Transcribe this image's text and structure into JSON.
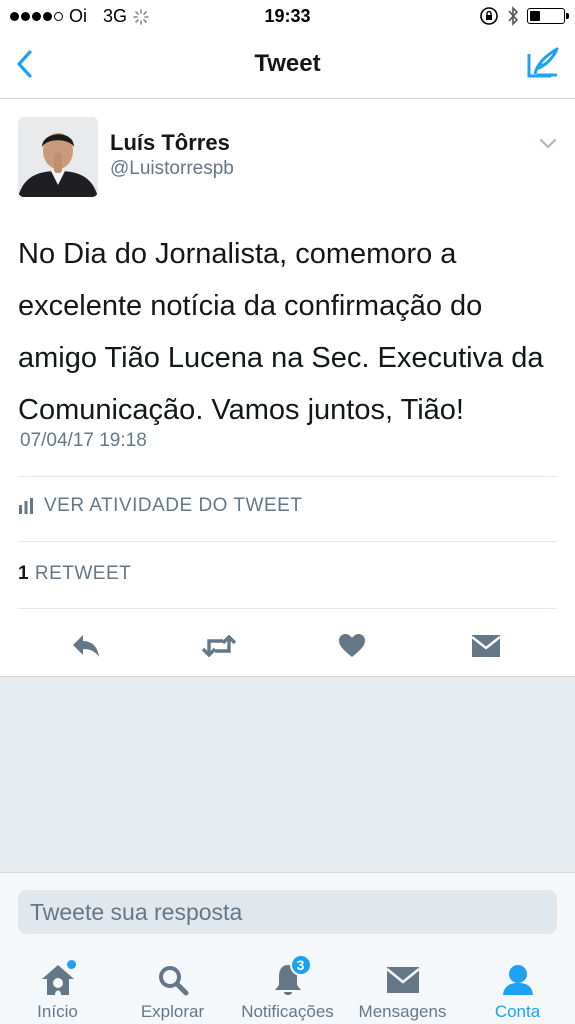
{
  "status_bar": {
    "carrier": "Oi",
    "network": "3G",
    "time": "19:33"
  },
  "nav": {
    "title": "Tweet"
  },
  "tweet": {
    "author_name": "Luís Tôrres",
    "author_handle": "@Luistorrespb",
    "text": "No Dia do Jornalista, comemoro a excelente notícia da confirmação do amigo Tião Lucena na Sec. Executiva da Comunicação. Vamos juntos, Tião!",
    "timestamp": "07/04/17 19:18",
    "activity_label": "VER ATIVIDADE DO TWEET",
    "retweet_count": "1",
    "retweet_label": "RETWEET"
  },
  "reply": {
    "placeholder": "Tweete sua resposta"
  },
  "tabs": [
    {
      "label": "Início",
      "icon": "home-icon"
    },
    {
      "label": "Explorar",
      "icon": "search-icon"
    },
    {
      "label": "Notificações",
      "icon": "bell-icon",
      "badge": "3"
    },
    {
      "label": "Mensagens",
      "icon": "envelope-icon"
    },
    {
      "label": "Conta",
      "icon": "person-icon"
    }
  ],
  "colors": {
    "accent": "#1da1f2",
    "secondary_text": "#657786",
    "action_icon": "#657786"
  }
}
